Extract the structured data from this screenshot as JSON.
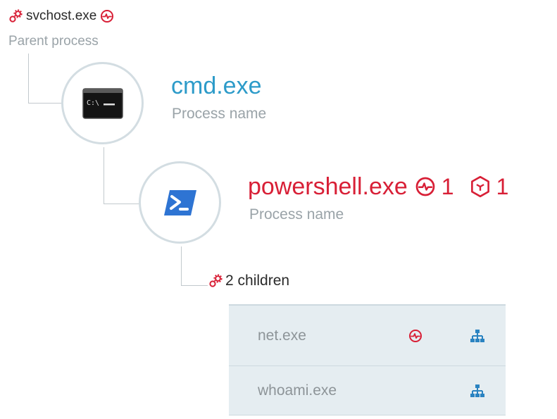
{
  "parent": {
    "name": "svchost.exe",
    "label": "Parent process"
  },
  "nodes": [
    {
      "name": "cmd.exe",
      "label": "Process name",
      "icon": "cmd-terminal-icon",
      "name_color": "#2d9bc9"
    },
    {
      "name": "powershell.exe",
      "label": "Process name",
      "icon": "powershell-icon",
      "name_color": "#d81f36",
      "alerts_count": "1",
      "incidents_count": "1"
    }
  ],
  "children": {
    "label": "2 children",
    "items": [
      {
        "name": "net.exe",
        "has_alert": true
      },
      {
        "name": "whoami.exe",
        "has_alert": false
      }
    ]
  },
  "colors": {
    "alert_red": "#d81f36",
    "accent_blue": "#2d9bc9",
    "process_tree_blue": "#2a83c1",
    "table_bg": "#e5edf1"
  }
}
